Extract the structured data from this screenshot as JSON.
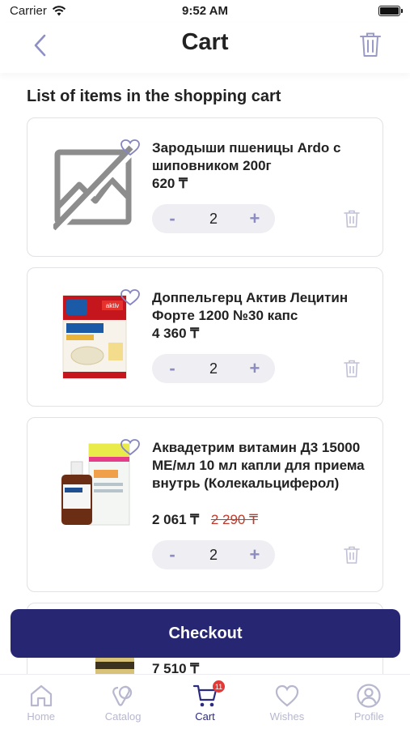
{
  "status_bar": {
    "carrier": "Carrier",
    "time": "9:52 AM"
  },
  "header": {
    "title": "Cart"
  },
  "section_title": "List of items in the shopping cart",
  "items": [
    {
      "name": "Зародыши пшеницы Ardo с шиповником 200г",
      "price": "620 ₸",
      "old_price": "",
      "qty": "2"
    },
    {
      "name": "Доппельгерц Актив Лецитин Форте 1200 №30 капс",
      "price": "4 360 ₸",
      "old_price": "",
      "qty": "2"
    },
    {
      "name": "Аквадетрим витамин Д3 15000 МЕ/мл 10 мл капли для приема внутрь (Колекальциферол)",
      "price": "2 061 ₸",
      "old_price": "2 290 ₸",
      "qty": "2"
    },
    {
      "name": "",
      "price": "7 510 ₸",
      "old_price": "",
      "qty": ""
    }
  ],
  "stepper": {
    "minus": "-",
    "plus": "+"
  },
  "checkout_label": "Checkout",
  "tabs": [
    {
      "label": "Home",
      "icon": "home-icon"
    },
    {
      "label": "Catalog",
      "icon": "catalog-icon"
    },
    {
      "label": "Cart",
      "icon": "cart-icon",
      "badge": "11"
    },
    {
      "label": "Wishes",
      "icon": "heart-icon"
    },
    {
      "label": "Profile",
      "icon": "profile-icon"
    }
  ],
  "colors": {
    "accent": "#262673",
    "inactive": "#b7b7cf",
    "badge": "#e53935",
    "old_price": "#c0392b"
  }
}
